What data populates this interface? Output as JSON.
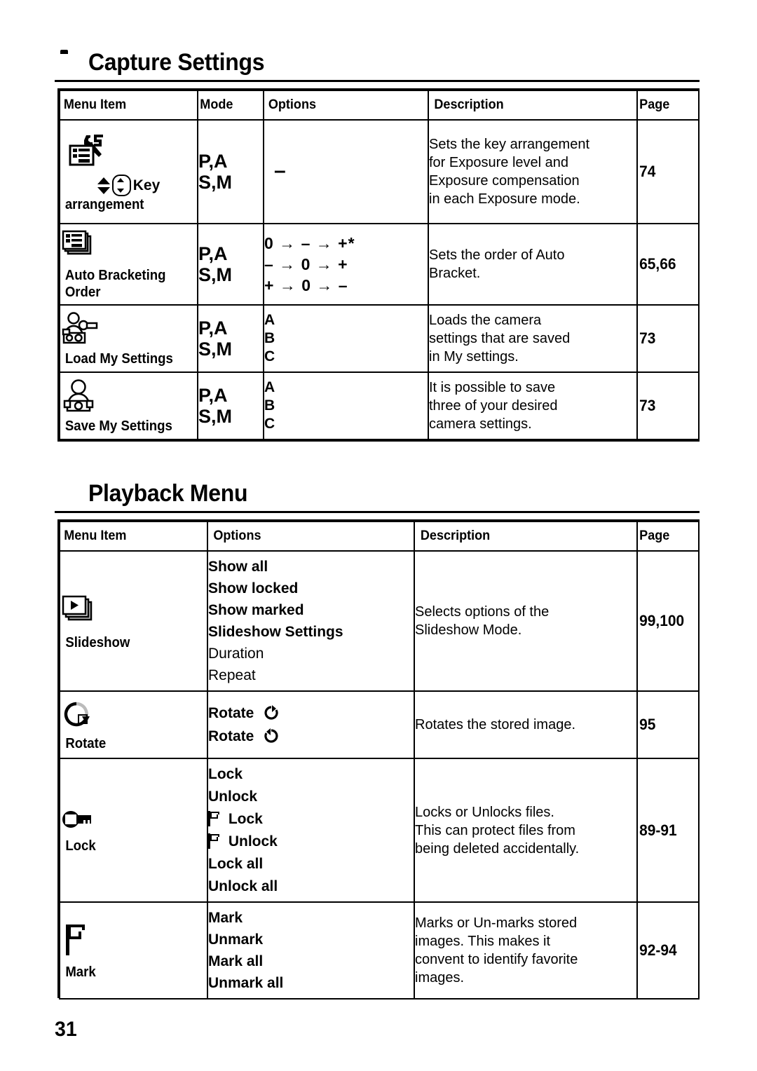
{
  "page_number": "31",
  "sections": [
    {
      "id": "capture-settings",
      "icon": "camera-icon",
      "title": "Capture Settings",
      "columns": [
        "Menu Item",
        "Mode",
        "Options",
        "Description",
        "Page"
      ],
      "rows": [
        {
          "icon": "key-arrangement-icon",
          "menu_item_lines": [
            "Key",
            "arrangement"
          ],
          "mode": [
            "P,A",
            "S,M"
          ],
          "options": [
            "–"
          ],
          "description": [
            "Sets the key arrangement",
            "for Exposure level and",
            "Exposure compensation",
            "in each Exposure mode."
          ],
          "page": "74"
        },
        {
          "icon": "auto-bracketing-icon",
          "menu_item_lines": [
            "Auto Bracketing",
            "Order"
          ],
          "mode": [
            "P,A",
            "S,M"
          ],
          "options": [
            "0 → – → +*",
            "– → 0 → +",
            "+ → 0 → –"
          ],
          "description": [
            "Sets the order of Auto",
            "Bracket."
          ],
          "page": "65,66"
        },
        {
          "icon": "load-my-settings-icon",
          "menu_item_lines": [
            "Load My Settings"
          ],
          "mode": [
            "P,A",
            "S,M"
          ],
          "options": [
            "A",
            "B",
            "C"
          ],
          "description": [
            "Loads the camera",
            "settings that are saved",
            "in My settings."
          ],
          "page": "73"
        },
        {
          "icon": "save-my-settings-icon",
          "menu_item_lines": [
            "Save My Settings"
          ],
          "mode": [
            "P,A",
            "S,M"
          ],
          "options": [
            "A",
            "B",
            "C"
          ],
          "description": [
            "It is possible to save",
            "three of your desired",
            "camera settings."
          ],
          "page": "73"
        }
      ]
    },
    {
      "id": "playback-menu",
      "icon": "playback-icon",
      "title": "Playback Menu",
      "columns": [
        "Menu Item",
        "Options",
        "Description",
        "Page"
      ],
      "rows": [
        {
          "icon": "slideshow-icon",
          "menu_item_lines": [
            "Slideshow"
          ],
          "options": [
            {
              "text": "Show all",
              "bold": true
            },
            {
              "text": "Show locked",
              "bold": true
            },
            {
              "text": "Show marked",
              "bold": true
            },
            {
              "text": "Slideshow Settings",
              "bold": true
            },
            {
              "text": "Duration",
              "bold": false
            },
            {
              "text": "Repeat",
              "bold": false
            }
          ],
          "description": [
            "Selects options of the",
            "Slideshow Mode."
          ],
          "page": "99,100"
        },
        {
          "icon": "rotate-icon",
          "menu_item_lines": [
            "Rotate"
          ],
          "options": [
            {
              "text": "Rotate",
              "bold": true,
              "glyph": "rotate-cw-icon"
            },
            {
              "text": "Rotate",
              "bold": true,
              "glyph": "rotate-ccw-icon"
            }
          ],
          "description": [
            "Rotates the stored image."
          ],
          "page": "95"
        },
        {
          "icon": "lock-key-icon",
          "menu_item_lines": [
            "Lock"
          ],
          "options": [
            {
              "text": "Lock",
              "bold": true
            },
            {
              "text": "Unlock",
              "bold": true
            },
            {
              "text": "Lock",
              "bold": true,
              "glyph": "flag-icon"
            },
            {
              "text": "Unlock",
              "bold": true,
              "glyph": "flag-icon"
            },
            {
              "text": "Lock all",
              "bold": true
            },
            {
              "text": "Unlock all",
              "bold": true
            }
          ],
          "description": [
            "Locks or Unlocks files.",
            "This can protect files from",
            "being deleted accidentally."
          ],
          "page": "89-91"
        },
        {
          "icon": "mark-flag-icon",
          "menu_item_lines": [
            "Mark"
          ],
          "options": [
            {
              "text": "Mark",
              "bold": true
            },
            {
              "text": "Unmark",
              "bold": true
            },
            {
              "text": "Mark all",
              "bold": true
            },
            {
              "text": "Unmark all",
              "bold": true
            }
          ],
          "description": [
            "Marks or Un-marks stored",
            "images. This makes it",
            "convent to identify favorite",
            "images."
          ],
          "page": "92-94"
        }
      ]
    }
  ]
}
